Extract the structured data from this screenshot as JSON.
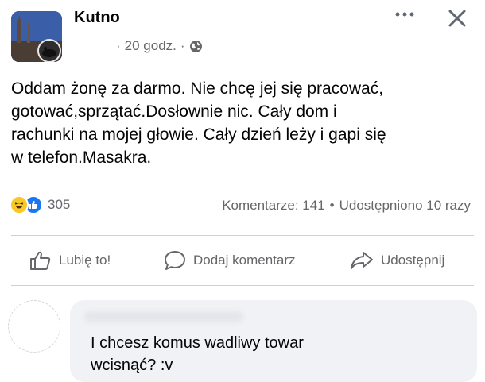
{
  "post": {
    "page_name": "Kutno",
    "time": "20 godz.",
    "separator": "·",
    "text_lines": [
      "Oddam żonę za darmo. Nie chcę jej się pracować,",
      "gotować,sprzątać.Dosłownie nic. Cały dom i",
      "rachunki na mojej głowie. Cały dzień leży i gapi się",
      "w  telefon.Masakra."
    ]
  },
  "stats": {
    "reaction_count": "305",
    "comments": "Komentarze: 141",
    "dot": "•",
    "shares": "Udostępniono 10 razy"
  },
  "actions": {
    "like": "Lubię to!",
    "comment": "Dodaj komentarz",
    "share": "Udostępnij"
  },
  "comment": {
    "text_lines": [
      "I chcesz komus wadliwy towar",
      "wcisnąć? :v"
    ]
  },
  "icons": {
    "more": "more-horizontal-icon",
    "close": "close-icon",
    "audience": "globe-icon",
    "like_action": "thumbs-up-icon",
    "comment_action": "speech-bubble-icon",
    "share_action": "share-arrow-icon"
  },
  "colors": {
    "text": "#050505",
    "secondary": "#65676b",
    "like_blue": "#1877f2",
    "haha_yellow": "#f7c928",
    "bubble": "#f0f2f5",
    "divider": "#ced0d4"
  }
}
